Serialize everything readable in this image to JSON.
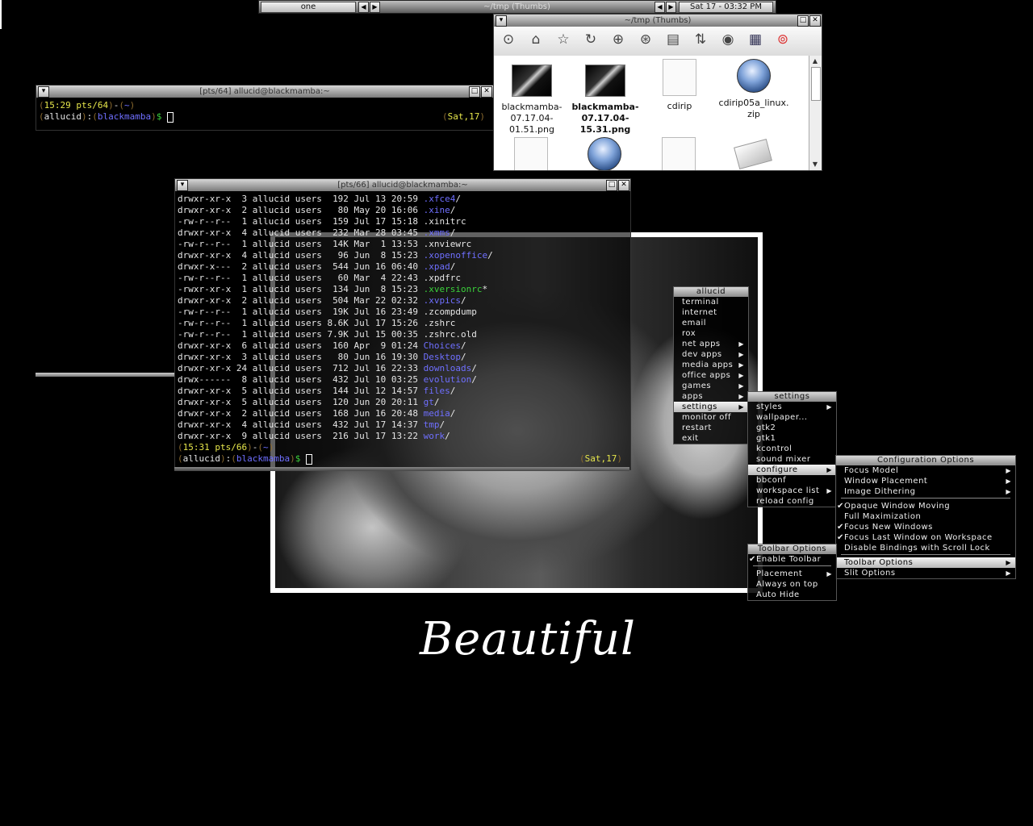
{
  "toolbar": {
    "workspace": "one",
    "window_title": "~/tmp (Thumbs)",
    "clock": "Sat 17 - 03:32 PM",
    "prev_workspace": "◀",
    "next_workspace": "▶",
    "prev_window": "◀",
    "next_window": "▶"
  },
  "term1": {
    "title": "[pts/64] allucid@blackmamba:~",
    "prompt": {
      "open": "(",
      "time": "15:29 pts/64",
      "close": ")",
      "dash": "-",
      "dir_open": "(",
      "dir": "~",
      "dir_close": ")",
      "user_open": "(",
      "user": "allucid",
      "user_close": ")",
      "colon": ":",
      "host_open": "(",
      "host": "blackmamba",
      "host_close": ")",
      "dollar": "$",
      "date_open": "(",
      "date": "Sat,17",
      "date_close": ")"
    }
  },
  "term2": {
    "title": "[pts/66] allucid@blackmamba:~",
    "rows": [
      {
        "perm": "drwxr-xr-x",
        "info": "  3 allucid users  192 Jul 13 20:59",
        "name": ".xfce4",
        "suffix": "/",
        "kind": "dir"
      },
      {
        "perm": "drwxr-xr-x",
        "info": "  2 allucid users   80 May 20 16:06",
        "name": ".xine",
        "suffix": "/",
        "kind": "dir"
      },
      {
        "perm": "-rw-r--r--",
        "info": "  1 allucid users  159 Jul 17 15:18",
        "name": ".xinitrc",
        "suffix": "",
        "kind": "file"
      },
      {
        "perm": "drwxr-xr-x",
        "info": "  4 allucid users  232 Mar 28 03:45",
        "name": ".xmms",
        "suffix": "/",
        "kind": "dir"
      },
      {
        "perm": "-rw-r--r--",
        "info": "  1 allucid users  14K Mar  1 13:53",
        "name": ".xnviewrc",
        "suffix": "",
        "kind": "file"
      },
      {
        "perm": "drwxr-xr-x",
        "info": "  4 allucid users   96 Jun  8 15:23",
        "name": ".xopenoffice",
        "suffix": "/",
        "kind": "dir"
      },
      {
        "perm": "drwxr-x---",
        "info": "  2 allucid users  544 Jun 16 06:40",
        "name": ".xpad",
        "suffix": "/",
        "kind": "dir"
      },
      {
        "perm": "-rw-r--r--",
        "info": "  1 allucid users   60 Mar  4 22:43",
        "name": ".xpdfrc",
        "suffix": "",
        "kind": "file"
      },
      {
        "perm": "-rwxr-xr-x",
        "info": "  1 allucid users  134 Jun  8 15:23",
        "name": ".xversionrc",
        "suffix": "*",
        "kind": "exec"
      },
      {
        "perm": "drwxr-xr-x",
        "info": "  2 allucid users  504 Mar 22 02:32",
        "name": ".xvpics",
        "suffix": "/",
        "kind": "dir"
      },
      {
        "perm": "-rw-r--r--",
        "info": "  1 allucid users  19K Jul 16 23:49",
        "name": ".zcompdump",
        "suffix": "",
        "kind": "file"
      },
      {
        "perm": "-rw-r--r--",
        "info": "  1 allucid users 8.6K Jul 17 15:26",
        "name": ".zshrc",
        "suffix": "",
        "kind": "file"
      },
      {
        "perm": "-rw-r--r--",
        "info": "  1 allucid users 7.9K Jul 15 00:35",
        "name": ".zshrc.old",
        "suffix": "",
        "kind": "file"
      },
      {
        "perm": "drwxr-xr-x",
        "info": "  6 allucid users  160 Apr  9 01:24",
        "name": "Choices",
        "suffix": "/",
        "kind": "dir"
      },
      {
        "perm": "drwxr-xr-x",
        "info": "  3 allucid users   80 Jun 16 19:30",
        "name": "Desktop",
        "suffix": "/",
        "kind": "dir"
      },
      {
        "perm": "drwxr-xr-x",
        "info": " 24 allucid users  712 Jul 16 22:33",
        "name": "downloads",
        "suffix": "/",
        "kind": "dir"
      },
      {
        "perm": "drwx------",
        "info": "  8 allucid users  432 Jul 10 03:25",
        "name": "evolution",
        "suffix": "/",
        "kind": "dir"
      },
      {
        "perm": "drwxr-xr-x",
        "info": "  5 allucid users  144 Jul 12 14:57",
        "name": "files",
        "suffix": "/",
        "kind": "dir"
      },
      {
        "perm": "drwxr-xr-x",
        "info": "  5 allucid users  120 Jun 20 20:11",
        "name": "gt",
        "suffix": "/",
        "kind": "dir"
      },
      {
        "perm": "drwxr-xr-x",
        "info": "  2 allucid users  168 Jun 16 20:48",
        "name": "media",
        "suffix": "/",
        "kind": "dir"
      },
      {
        "perm": "drwxr-xr-x",
        "info": "  4 allucid users  432 Jul 17 14:37",
        "name": "tmp",
        "suffix": "/",
        "kind": "dir"
      },
      {
        "perm": "drwxr-xr-x",
        "info": "  9 allucid users  216 Jul 17 13:22",
        "name": "work",
        "suffix": "/",
        "kind": "dir"
      }
    ],
    "prompt": {
      "time": "15:31 pts/66",
      "dir": "~",
      "user": "allucid",
      "host": "blackmamba",
      "dollar": "$",
      "date": "Sat,17"
    }
  },
  "thumbs": {
    "title": "~/tmp (Thumbs)",
    "toolbar_icons": [
      "up-icon",
      "home-icon",
      "bookmark-icon",
      "refresh-icon",
      "zoom-in-icon",
      "zoom-fit-icon",
      "list-icon",
      "sort-icon",
      "eye-icon",
      "details-icon",
      "help-icon"
    ],
    "items": [
      {
        "label": "blackmamba-\n07.17.04-\n01.51.png",
        "kind": "screen",
        "bold": false
      },
      {
        "label": "blackmamba-\n07.17.04-\n15.31.png",
        "kind": "screen",
        "bold": true
      },
      {
        "label": "cdirip",
        "kind": "doc",
        "bold": false
      },
      {
        "label": "cdirip05a_linux.\nzip",
        "kind": "zip",
        "bold": false
      }
    ]
  },
  "wallpaper": {
    "caption": "Beautiful"
  },
  "root_menu": {
    "title": "allucid",
    "items": [
      {
        "label": "terminal",
        "arrow": false
      },
      {
        "label": "internet",
        "arrow": false
      },
      {
        "label": "email",
        "arrow": false
      },
      {
        "label": "rox",
        "arrow": false
      },
      {
        "label": "net apps",
        "arrow": true
      },
      {
        "label": "dev apps",
        "arrow": true
      },
      {
        "label": "media apps",
        "arrow": true
      },
      {
        "label": "office apps",
        "arrow": true
      },
      {
        "label": "games",
        "arrow": true
      },
      {
        "label": "apps",
        "arrow": true
      },
      {
        "label": "settings",
        "arrow": true,
        "selected": true
      },
      {
        "label": "monitor off",
        "arrow": false
      },
      {
        "label": "restart",
        "arrow": false
      },
      {
        "label": "exit",
        "arrow": false
      }
    ]
  },
  "settings_menu": {
    "title": "settings",
    "items": [
      {
        "label": "styles",
        "arrow": true
      },
      {
        "label": "wallpaper...",
        "arrow": false
      },
      {
        "label": "gtk2",
        "arrow": false
      },
      {
        "label": "gtk1",
        "arrow": false
      },
      {
        "label": "kcontrol",
        "arrow": false
      },
      {
        "label": "sound mixer",
        "arrow": false
      },
      {
        "label": "configure",
        "arrow": true,
        "selected": true
      },
      {
        "label": "bbconf",
        "arrow": false
      },
      {
        "label": "workspace list",
        "arrow": true
      },
      {
        "label": "reload config",
        "arrow": false
      }
    ]
  },
  "config_menu": {
    "title": "Configuration Options",
    "items": [
      {
        "label": "Focus Model",
        "arrow": true
      },
      {
        "label": "Window Placement",
        "arrow": true
      },
      {
        "label": "Image Dithering",
        "arrow": true
      },
      {
        "separator": true
      },
      {
        "label": "Opaque Window Moving",
        "check": true
      },
      {
        "label": "Full Maximization"
      },
      {
        "label": "Focus New Windows",
        "check": true
      },
      {
        "label": "Focus Last Window on Workspace",
        "check": true
      },
      {
        "label": "Disable Bindings with Scroll Lock"
      },
      {
        "separator": true
      },
      {
        "label": "Toolbar Options",
        "arrow": true,
        "selected": true
      },
      {
        "label": "Slit Options",
        "arrow": true
      }
    ]
  },
  "toolbar_options_menu": {
    "title": "Toolbar Options",
    "items": [
      {
        "label": "Enable Toolbar",
        "check": true
      },
      {
        "separator": true
      },
      {
        "label": "Placement",
        "arrow": true
      },
      {
        "label": "Always on top"
      },
      {
        "label": "Auto Hide"
      }
    ]
  }
}
